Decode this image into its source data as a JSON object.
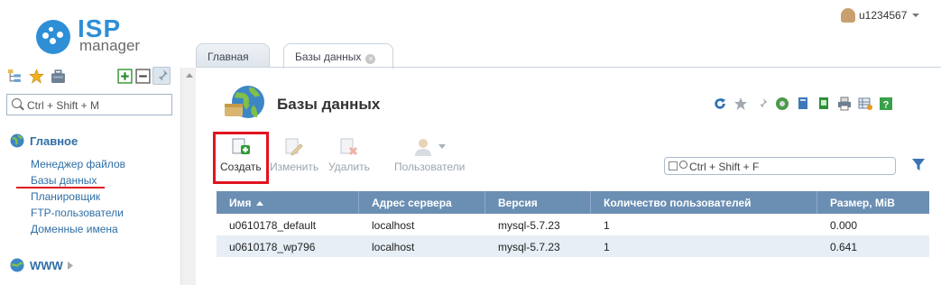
{
  "app": {
    "logo_isp": "ISP",
    "logo_manager": "manager",
    "user": "u1234567"
  },
  "colors": {
    "accent": "#2e8fd6",
    "nav_link": "#2f6ea5",
    "table_header": "#6b8fb3",
    "highlight": "#e0141e"
  },
  "sidebar": {
    "search_placeholder": "Ctrl + Shift + M",
    "groups": [
      {
        "label": "Главное",
        "icon": "globe-icon",
        "expanded": true,
        "items": [
          "Менеджер файлов",
          "Базы данных",
          "Планировщик",
          "FTP-пользователи",
          "Доменные имена"
        ]
      },
      {
        "label": "WWW",
        "icon": "www-globe-icon",
        "expanded": false
      }
    ],
    "active_item": "Базы данных",
    "tools": [
      "tree-icon",
      "star-icon",
      "briefcase-icon",
      "expand-all-icon",
      "collapse-all-icon",
      "pin-icon"
    ]
  },
  "tabs": [
    {
      "label": "Главная",
      "active": false
    },
    {
      "label": "Базы данных",
      "active": true,
      "closable": true
    }
  ],
  "page": {
    "title": "Базы данных"
  },
  "header_icons": [
    "refresh-icon",
    "star-icon",
    "pin-icon",
    "globe-settings-icon",
    "copy-icon",
    "export-icon",
    "print-icon",
    "settings-table-icon",
    "help-icon"
  ],
  "toolbar": {
    "create": "Создать",
    "edit": "Изменить",
    "delete": "Удалить",
    "users": "Пользователи"
  },
  "search": {
    "placeholder": "Ctrl + Shift + F"
  },
  "table": {
    "columns": [
      "Имя",
      "Адрес сервера",
      "Версия",
      "Количество пользователей",
      "Размер, MiB"
    ],
    "sort_column": "Имя",
    "rows": [
      {
        "name": "u0610178_default",
        "server": "localhost",
        "version": "mysql-5.7.23",
        "users": "1",
        "size": "0.000"
      },
      {
        "name": "u0610178_wp796",
        "server": "localhost",
        "version": "mysql-5.7.23",
        "users": "1",
        "size": "0.641"
      }
    ]
  }
}
